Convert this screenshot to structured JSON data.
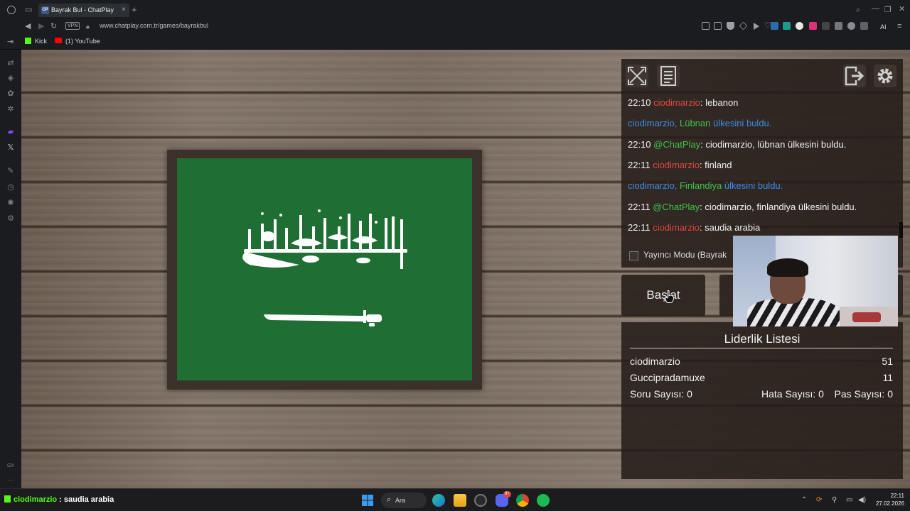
{
  "browser": {
    "tab_title": "Bayrak Bul - ChatPlay",
    "tab_favicon": "CP",
    "vpn_label": "VPN",
    "url": "www.chatplay.com.tr/games/bayrakbul",
    "ai_label": "AI",
    "bookmarks": [
      {
        "label": "Kick",
        "icon": "kick-icon",
        "color": "#53fc18"
      },
      {
        "label": "(1) YouTube",
        "icon": "youtube-icon",
        "color": "#ff0000"
      }
    ]
  },
  "sidebar": {
    "icons": [
      "translate-icon",
      "navigation-icon",
      "gamepad-icon",
      "puzzle-icon",
      "twitch-icon",
      "x-icon",
      "feather-icon",
      "clock-icon",
      "globe-icon",
      "settings-icon"
    ],
    "footer_label": "GX",
    "more_label": "···"
  },
  "game": {
    "flag_country": "Saudi Arabia",
    "flag_color": "#1f6e34",
    "controls": [
      "fullscreen-icon",
      "document-icon",
      "exit-icon",
      "gear-icon"
    ],
    "chat": [
      {
        "time": "22:10",
        "user": "ciodimarzio",
        "text": ": lebanon"
      },
      {
        "user": "ciodimarzio,",
        "country": "Lübnan",
        "text": "ülkesini buldu."
      },
      {
        "time": "22:10",
        "user": "@ChatPlay",
        "text": ": ciodimarzio, lübnan ülkesini buldu."
      },
      {
        "time": "22:11",
        "user": "ciodimarzio",
        "text": ": finland"
      },
      {
        "user": "ciodimarzio,",
        "country": "Finlandiya",
        "text": "ülkesini buldu."
      },
      {
        "time": "22:11",
        "user": "@ChatPlay",
        "text": ": ciodimarzio, finlandiya ülkesini buldu."
      },
      {
        "time": "22:11",
        "user": "ciodimarzio",
        "text": ": saudia arabia"
      }
    ],
    "streamer_mode_label": "Yayıncı Modu (Bayrak",
    "start_button_label": "Başlat",
    "leaderboard": {
      "title": "Liderlik Listesi",
      "rows": [
        {
          "name": "ciodimarzio",
          "score": "51"
        },
        {
          "name": "Guccipradamuxe",
          "score": "11"
        }
      ],
      "stats": {
        "questions": "Soru Sayısı: 0",
        "errors": "Hata Sayısı: 0",
        "passes": "Pas Sayısı: 0"
      }
    }
  },
  "taskbar": {
    "chat_user": "ciodimarzio",
    "chat_text": " : saudia arabia",
    "search_label": "Ara",
    "discord_badge": "9+",
    "clock_time": "22:11",
    "clock_date": "27.02.2026",
    "apps": [
      "windows-start-icon",
      "search-icon",
      "edge-icon",
      "file-explorer-icon",
      "opera-gx-icon",
      "discord-icon",
      "chrome-icon",
      "spotify-icon"
    ]
  }
}
